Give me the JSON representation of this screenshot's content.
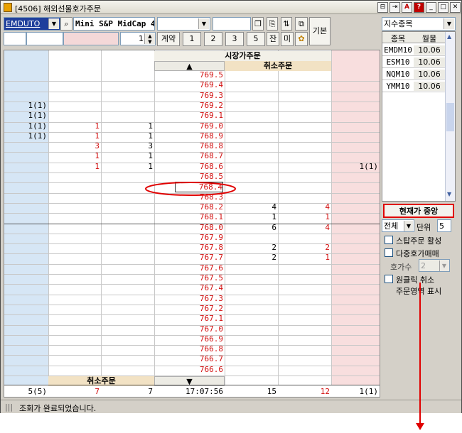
{
  "window": {
    "title": "[4506] 해외선물호가주문",
    "title_buttons": [
      "⊟",
      "⇥",
      "A",
      "?",
      "_",
      "□",
      "✕"
    ]
  },
  "toolbar": {
    "symbol_code": "EMDUTO",
    "symbol_name": "Mini S&P MidCap 4",
    "qty_value": "1",
    "qty_label": "계약",
    "preset_buttons": [
      "1",
      "2",
      "3",
      "5"
    ],
    "btn_remain": "잔",
    "btn_mi": "미",
    "btn_basic": "기본"
  },
  "grid": {
    "header_market": "시장가주문",
    "header_cancel_top": "취소주문",
    "header_cancel_bottom": "취소주문",
    "up_arrow": "▲",
    "down_arrow": "▼",
    "rows": [
      {
        "c1": "",
        "c2": "",
        "c3": "",
        "price": "769.5",
        "c5": "",
        "c6": "",
        "c7": ""
      },
      {
        "c1": "",
        "c2": "",
        "c3": "",
        "price": "769.4",
        "c5": "",
        "c6": "",
        "c7": ""
      },
      {
        "c1": "",
        "c2": "",
        "c3": "",
        "price": "769.3",
        "c5": "",
        "c6": "",
        "c7": ""
      },
      {
        "c1": "1(1)",
        "c2": "",
        "c3": "",
        "price": "769.2",
        "c5": "",
        "c6": "",
        "c7": ""
      },
      {
        "c1": "1(1)",
        "c2": "",
        "c3": "",
        "price": "769.1",
        "c5": "",
        "c6": "",
        "c7": ""
      },
      {
        "c1": "1(1)",
        "c2": "1",
        "c3": "1",
        "price": "769.0",
        "c5": "",
        "c6": "",
        "c7": ""
      },
      {
        "c1": "1(1)",
        "c2": "1",
        "c3": "1",
        "price": "768.9",
        "c5": "",
        "c6": "",
        "c7": ""
      },
      {
        "c1": "",
        "c2": "3",
        "c3": "3",
        "price": "768.8",
        "c5": "",
        "c6": "",
        "c7": ""
      },
      {
        "c1": "",
        "c2": "1",
        "c3": "1",
        "price": "768.7",
        "c5": "",
        "c6": "",
        "c7": ""
      },
      {
        "c1": "",
        "c2": "1",
        "c3": "1",
        "price": "768.6",
        "c5": "",
        "c6": "",
        "c7": "1(1)"
      },
      {
        "c1": "",
        "c2": "",
        "c3": "",
        "price": "768.5",
        "c5": "",
        "c6": "",
        "c7": ""
      },
      {
        "c1": "",
        "c2": "",
        "c3": "",
        "price": "768.4",
        "c5": "",
        "c6": "",
        "c7": ""
      },
      {
        "c1": "",
        "c2": "",
        "c3": "",
        "price": "768.3",
        "c5": "",
        "c6": "",
        "c7": ""
      },
      {
        "c1": "",
        "c2": "",
        "c3": "",
        "price": "768.2",
        "c5": "4",
        "c6": "4",
        "c7": ""
      },
      {
        "c1": "",
        "c2": "",
        "c3": "",
        "price": "768.1",
        "c5": "1",
        "c6": "1",
        "c7": ""
      },
      {
        "c1": "",
        "c2": "",
        "c3": "",
        "price": "768.0",
        "c5": "6",
        "c6": "4",
        "c7": ""
      },
      {
        "c1": "",
        "c2": "",
        "c3": "",
        "price": "767.9",
        "c5": "",
        "c6": "",
        "c7": ""
      },
      {
        "c1": "",
        "c2": "",
        "c3": "",
        "price": "767.8",
        "c5": "2",
        "c6": "2",
        "c7": ""
      },
      {
        "c1": "",
        "c2": "",
        "c3": "",
        "price": "767.7",
        "c5": "2",
        "c6": "1",
        "c7": ""
      },
      {
        "c1": "",
        "c2": "",
        "c3": "",
        "price": "767.6",
        "c5": "",
        "c6": "",
        "c7": ""
      },
      {
        "c1": "",
        "c2": "",
        "c3": "",
        "price": "767.5",
        "c5": "",
        "c6": "",
        "c7": ""
      },
      {
        "c1": "",
        "c2": "",
        "c3": "",
        "price": "767.4",
        "c5": "",
        "c6": "",
        "c7": ""
      },
      {
        "c1": "",
        "c2": "",
        "c3": "",
        "price": "767.3",
        "c5": "",
        "c6": "",
        "c7": ""
      },
      {
        "c1": "",
        "c2": "",
        "c3": "",
        "price": "767.2",
        "c5": "",
        "c6": "",
        "c7": ""
      },
      {
        "c1": "",
        "c2": "",
        "c3": "",
        "price": "767.1",
        "c5": "",
        "c6": "",
        "c7": ""
      },
      {
        "c1": "",
        "c2": "",
        "c3": "",
        "price": "767.0",
        "c5": "",
        "c6": "",
        "c7": ""
      },
      {
        "c1": "",
        "c2": "",
        "c3": "",
        "price": "766.9",
        "c5": "",
        "c6": "",
        "c7": ""
      },
      {
        "c1": "",
        "c2": "",
        "c3": "",
        "price": "766.8",
        "c5": "",
        "c6": "",
        "c7": ""
      },
      {
        "c1": "",
        "c2": "",
        "c3": "",
        "price": "766.7",
        "c5": "",
        "c6": "",
        "c7": ""
      },
      {
        "c1": "",
        "c2": "",
        "c3": "",
        "price": "766.6",
        "c5": "",
        "c6": "",
        "c7": ""
      }
    ],
    "footer": {
      "c1": "5(5)",
      "c2": "7",
      "c3": "7",
      "time": "17:07:56",
      "c5": "15",
      "c6": "12",
      "c7": "1(1)"
    }
  },
  "status": {
    "message": "조회가 완료되었습니다."
  },
  "sidebar": {
    "dropdown_value": "지수종목",
    "col_symbol": "종목",
    "col_month": "월물",
    "items": [
      {
        "symbol": "EMDM10",
        "month": "10.06"
      },
      {
        "symbol": "ESM10",
        "month": "10.06"
      },
      {
        "symbol": "NQM10",
        "month": "10.06"
      },
      {
        "symbol": "YMM10",
        "month": "10.06"
      }
    ],
    "center_button": "현재가 중앙",
    "scope_value": "전체",
    "unit_label": "단위",
    "unit_value": "5",
    "chk_stop": "스탑주문 활성",
    "chk_multi": "다중호가매매",
    "ask_count_label": "호가수",
    "ask_count_value": "2",
    "chk_oneclick": "원클릭 취소",
    "order_area_label": "주문영역 표시"
  },
  "colors": {
    "price_red": "#d31010",
    "ask_shade": "#d6e6f5",
    "bid_shade": "#f8dede",
    "header_tan": "#f2e2c4",
    "highlight_red": "#e00000"
  }
}
